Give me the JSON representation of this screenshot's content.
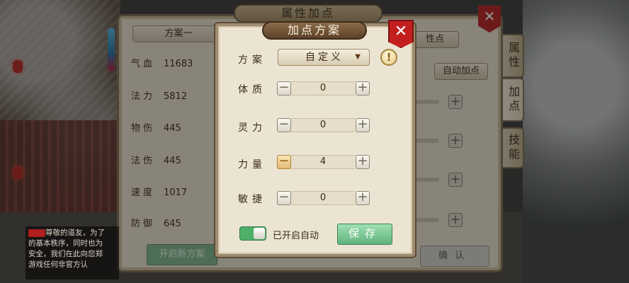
{
  "window": {
    "title": "属性加点",
    "close_label": "✕"
  },
  "back_panel": {
    "scheme_tab": "方案一",
    "right_tab": "性点",
    "auto_add_button": "自动加点",
    "stats": [
      {
        "name": "气血",
        "value": "11683"
      },
      {
        "name": "法力",
        "value": "5812"
      },
      {
        "name": "物伤",
        "value": "445"
      },
      {
        "name": "法伤",
        "value": "445"
      },
      {
        "name": "速度",
        "value": "1017"
      },
      {
        "name": "防御",
        "value": "645"
      }
    ],
    "side_tabs": [
      {
        "label": "属性",
        "active": false
      },
      {
        "label": "加点",
        "active": true
      },
      {
        "label": "技能",
        "active": false
      }
    ],
    "open_new_scheme_button": "开启新方案",
    "confirm_button": "确认"
  },
  "chat": {
    "lines": [
      "尊敬的道友，为了",
      "的基本秩序，同时也为",
      "安全，我们在此向您郑",
      "游戏任何非官方认"
    ]
  },
  "dialog": {
    "title": "加点方案",
    "close_label": "✕",
    "scheme_label": "方案",
    "scheme_value": "自定义",
    "info_icon": "!",
    "attributes": [
      {
        "name": "体质",
        "value": "0",
        "minus_active": false
      },
      {
        "name": "灵力",
        "value": "0",
        "minus_active": false
      },
      {
        "name": "力量",
        "value": "4",
        "minus_active": true
      },
      {
        "name": "敏捷",
        "value": "0",
        "minus_active": false
      }
    ],
    "minus_symbol": "−",
    "plus_symbol": "+",
    "auto_toggle_label": "已开启自动",
    "auto_toggle_on": true,
    "save_button": "保存"
  },
  "colors": {
    "close_red": "#c41f1f",
    "save_green": "#61b27d",
    "toggle_green": "#4fb06a",
    "panel_bg": "#ece4d3"
  }
}
